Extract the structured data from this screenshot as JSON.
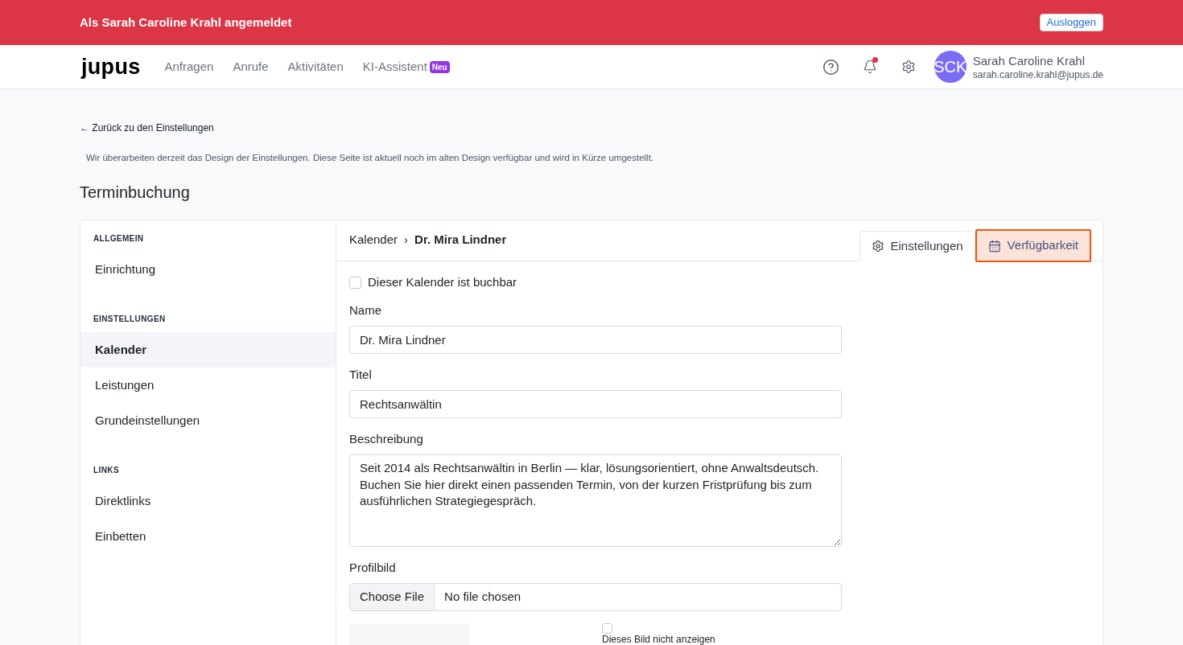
{
  "banner": {
    "text": "Als Sarah Caroline Krahl angemeldet",
    "button": "Ausloggen"
  },
  "navbar": {
    "logo": "jupus",
    "links": [
      {
        "label": "Anfragen"
      },
      {
        "label": "Anrufe"
      },
      {
        "label": "Aktivitäten"
      },
      {
        "label": "KI-Assistent",
        "badge": "Neu"
      }
    ],
    "notifications": {
      "unread": true
    },
    "user": {
      "initials": "SCK",
      "name": "Sarah Caroline Krahl",
      "email": "sarah.caroline.krahl@jupus.de"
    }
  },
  "back_link": "← Zurück zu den Einstellungen",
  "notice": "Wir überarbeiten derzeit das Design der Einstellungen. Diese Seite ist aktuell noch im alten Design verfügbar und wird in Kürze umgestellt.",
  "title": "Terminbuchung",
  "sidebar": {
    "sections": [
      {
        "heading": "ALLGEMEIN",
        "items": [
          {
            "label": "Einrichtung",
            "selected": false
          }
        ]
      },
      {
        "heading": "EINSTELLUNGEN",
        "items": [
          {
            "label": "Kalender",
            "selected": true
          },
          {
            "label": "Leistungen",
            "selected": false
          },
          {
            "label": "Grundeinstellungen",
            "selected": false
          }
        ]
      },
      {
        "heading": "LINKS",
        "items": [
          {
            "label": "Direktlinks",
            "selected": false
          },
          {
            "label": "Einbetten",
            "selected": false
          }
        ]
      }
    ]
  },
  "breadcrumb": {
    "parent": "Kalender",
    "separator": "›",
    "current": "Dr. Mira Lindner"
  },
  "tabs": [
    {
      "label": "Einstellungen",
      "selected": true,
      "highlighted": false
    },
    {
      "label": "Verfügbarkeit",
      "selected": false,
      "highlighted": true
    }
  ],
  "form": {
    "bookable": {
      "label": "Dieser Kalender ist buchbar",
      "checked": false
    },
    "fields": [
      {
        "kind": "text",
        "label": "Name",
        "value": "Dr. Mira Lindner"
      },
      {
        "kind": "text",
        "label": "Titel",
        "value": "Rechtsanwältin"
      },
      {
        "kind": "textarea",
        "label": "Beschreibung",
        "value": "Seit 2014 als Rechtsanwältin in Berlin — klar, lösungsorientiert, ohne Anwaltsdeutsch. Buchen Sie hier direkt einen passenden Termin, von der kurzen Fristprüfung bis zum ausführlichen Strategiegespräch."
      },
      {
        "kind": "file",
        "label": "Profilbild",
        "button": "Choose File",
        "value": "No file chosen"
      }
    ],
    "hide_image": {
      "label": "Dieses Bild nicht anzeigen",
      "checked": false
    }
  }
}
